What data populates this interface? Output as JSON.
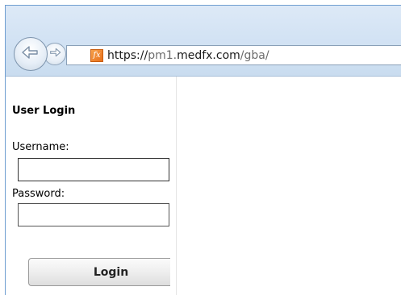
{
  "browser": {
    "back_icon": "back-arrow-icon",
    "forward_icon": "forward-arrow-icon",
    "favicon": {
      "icon": "medfx-fx-icon",
      "label": "fx",
      "color": "#e8711c"
    },
    "address": {
      "scheme": "https://",
      "host_sub": "pm1.",
      "host_domain": "medfx.com",
      "path": "/gba/"
    }
  },
  "login": {
    "title": "User Login",
    "username_label": "Username:",
    "username_value": "",
    "password_label": "Password:",
    "password_value": "",
    "button_label": "Login"
  }
}
